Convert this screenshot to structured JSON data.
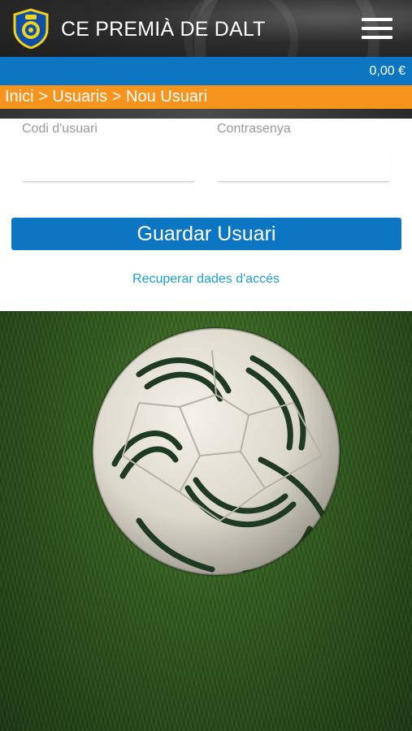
{
  "header": {
    "club_name": "CE PREMIÀ DE DALT",
    "logo_icon": "club-crest-icon",
    "menu_icon": "hamburger-menu-icon"
  },
  "cart": {
    "amount": "0,00 €"
  },
  "breadcrumb": {
    "items": [
      "Inici",
      "Usuaris",
      "Nou Usuari"
    ],
    "separator": ">"
  },
  "form": {
    "user_code_label": "Codi d'usuari",
    "user_code_value": "",
    "password_label": "Contrasenya",
    "password_value": "",
    "save_label": "Guardar Usuari",
    "recover_label": "Recuperar dades d'accés"
  },
  "colors": {
    "primary_blue": "#0d76c2",
    "breadcrumb_orange": "#f7941d",
    "link_blue": "#1a9fd8"
  },
  "background": {
    "image": "soccer-ball-on-grass"
  }
}
